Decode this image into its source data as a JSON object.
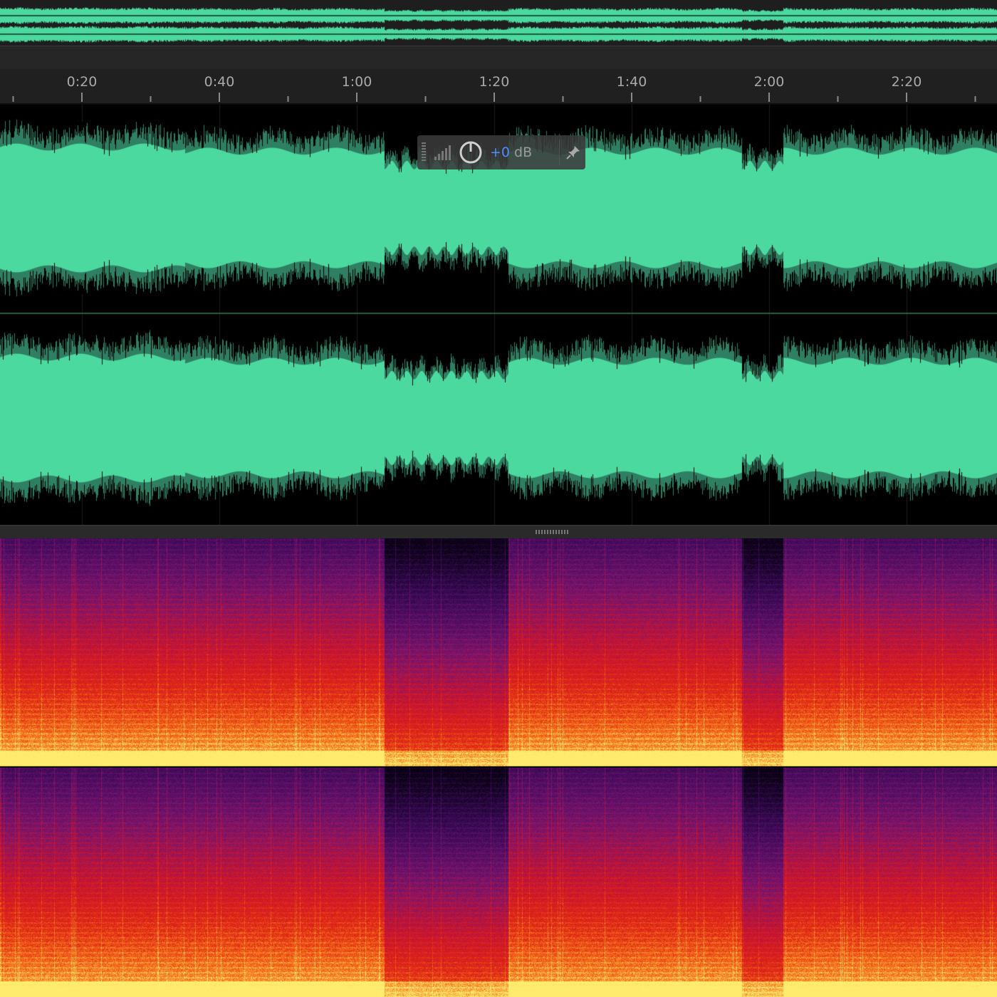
{
  "app": {
    "view": "waveform-and-spectral-frequency"
  },
  "colors": {
    "waveform": "#4cd9a0",
    "waveform_shadow": "#2f7f62",
    "background": "#000000",
    "ruler_text": "#a9a9a9",
    "hud_value": "#4e8cff",
    "spectral_low": "#1a0530",
    "spectral_mid": "#d3181c",
    "spectral_high": "#ffe66a"
  },
  "timeline": {
    "labels": [
      "0:20",
      "0:40",
      "1:00",
      "1:20",
      "1:40",
      "2:00",
      "2:20"
    ],
    "label_seconds": [
      20,
      40,
      60,
      80,
      100,
      120,
      140
    ]
  },
  "hud": {
    "value": "+0",
    "unit": "dB",
    "icons": [
      "grip-icon",
      "level-meter-icon",
      "volume-knob-icon",
      "pin-icon"
    ]
  },
  "waveform": {
    "channels": 2,
    "loud_sections_seconds": [
      [
        0,
        64
      ],
      [
        82,
        116
      ],
      [
        122,
        146
      ]
    ],
    "quiet_sections_seconds": [
      [
        64,
        82
      ],
      [
        116,
        122
      ]
    ]
  },
  "spectral": {
    "channels": 2,
    "quiet_sections_seconds": [
      [
        64,
        82
      ],
      [
        116,
        122
      ]
    ]
  }
}
